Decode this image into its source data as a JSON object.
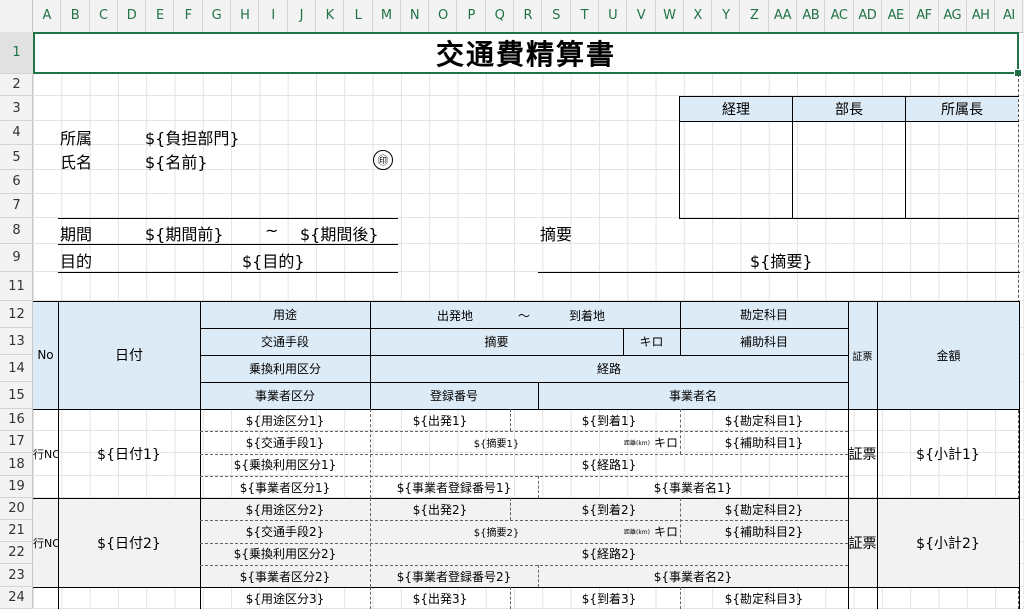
{
  "columns": [
    "A",
    "B",
    "C",
    "D",
    "E",
    "F",
    "G",
    "H",
    "I",
    "J",
    "K",
    "L",
    "M",
    "N",
    "O",
    "P",
    "Q",
    "R",
    "S",
    "T",
    "U",
    "V",
    "W",
    "X",
    "Y",
    "Z",
    "AA",
    "AB",
    "AC",
    "AD",
    "AE",
    "AF",
    "AG",
    "AH",
    "AI"
  ],
  "rows": [
    "1",
    "2",
    "3",
    "4",
    "5",
    "6",
    "7",
    "8",
    "9",
    "11",
    "12",
    "13",
    "14",
    "15",
    "16",
    "17",
    "18",
    "19",
    "20",
    "21",
    "22",
    "23",
    "24"
  ],
  "title": "交通費精算書",
  "approval": {
    "manager": "経理",
    "director": "部長",
    "dept_head": "所属長"
  },
  "header": {
    "affiliation_label": "所属",
    "affiliation_value": "${負担部門}",
    "name_label": "氏名",
    "name_value": "${名前}",
    "seal": "㊞",
    "period_label": "期間",
    "period_start": "${期間前}",
    "tilde": "~",
    "period_end": "${期間後}",
    "purpose_label": "目的",
    "purpose_value": "${目的}",
    "summary_label": "摘要",
    "summary_value": "${摘要}"
  },
  "table_header": {
    "no": "No",
    "date": "日付",
    "usage": "用途",
    "departure": "出発地",
    "tilde": "～",
    "arrival": "到着地",
    "account": "勘定科目",
    "transport": "交通手段",
    "memo": "摘要",
    "km": "キロ",
    "sub_account": "補助科目",
    "transfer": "乗換利用区分",
    "route": "経路",
    "business_type": "事業者区分",
    "reg_no": "登録番号",
    "business_name": "事業者名",
    "receipt": "証票",
    "amount": "金額"
  },
  "records": [
    {
      "no": "行NO",
      "date": "${日付1}",
      "usage": "${用途区分1}",
      "dep": "${出発1}",
      "arr": "${到着1}",
      "account": "${勘定科目1}",
      "transport": "${交通手段1}",
      "memo": "${摘要1}",
      "km_small": "距離(km)",
      "km": "キロ",
      "sub_account": "${補助科目1}",
      "transfer": "${乗換利用区分1}",
      "route": "${経路1}",
      "business_type": "${事業者区分1}",
      "reg_no": "${事業者登録番号1}",
      "business_name": "${事業者名1}",
      "receipt": "証票",
      "subtotal": "${小計1}"
    },
    {
      "no": "行NO",
      "date": "${日付2}",
      "usage": "${用途区分2}",
      "dep": "${出発2}",
      "arr": "${到着2}",
      "account": "${勘定科目2}",
      "transport": "${交通手段2}",
      "memo": "${摘要2}",
      "km_small": "距離(km)",
      "km": "キロ",
      "sub_account": "${補助科目2}",
      "transfer": "${乗換利用区分2}",
      "route": "${経路2}",
      "business_type": "${事業者区分2}",
      "reg_no": "${事業者登録番号2}",
      "business_name": "${事業者名2}",
      "receipt": "証票",
      "subtotal": "${小計2}"
    },
    {
      "usage": "${用途区分3}",
      "dep": "${出発3}",
      "arr": "${到着3}",
      "account": "${勘定科目3}"
    }
  ]
}
